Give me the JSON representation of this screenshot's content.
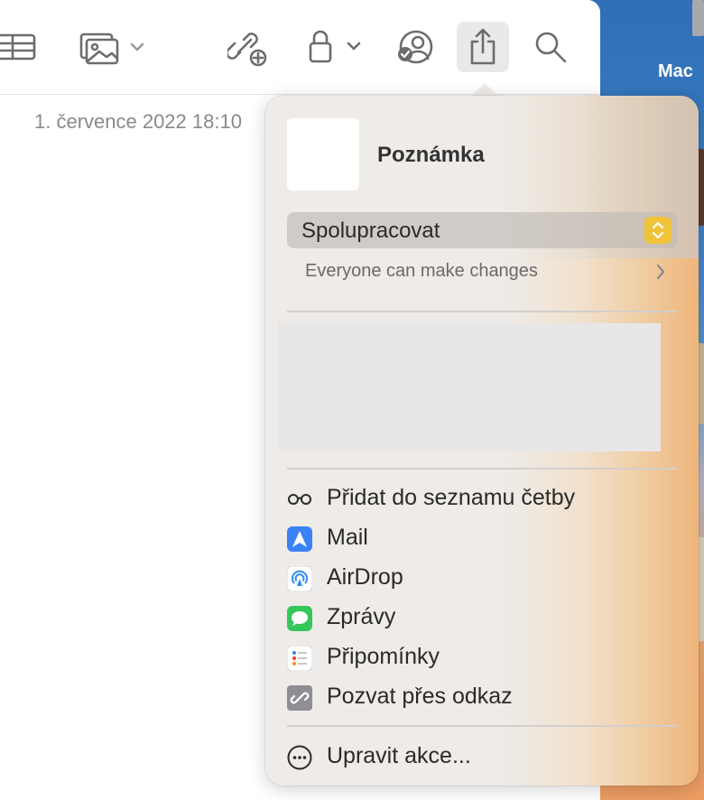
{
  "desktop": {
    "label": "Mac"
  },
  "toolbar": {
    "table_icon": "table-icon",
    "media_icon": "photo-icon",
    "collab_icon": "link-add-icon",
    "lock_icon": "lock-icon",
    "collab_status_icon": "person-check-icon",
    "share_icon": "share-icon",
    "search_icon": "search-icon"
  },
  "note": {
    "date": "1. července 2022 18:10"
  },
  "popover": {
    "title": "Poznámka",
    "mode_select": {
      "value": "Spolupracovat"
    },
    "permissions": "Everyone can make changes",
    "menu": [
      {
        "label": "Přidat do seznamu četby",
        "icon": "glasses-icon"
      },
      {
        "label": "Mail",
        "icon": "mail-icon",
        "color": "#3b82f6"
      },
      {
        "label": "AirDrop",
        "icon": "airdrop-icon",
        "color": "#2f8cf0"
      },
      {
        "label": "Zprávy",
        "icon": "messages-icon",
        "color": "#34c759"
      },
      {
        "label": "Připomínky",
        "icon": "reminders-icon"
      },
      {
        "label": "Pozvat přes odkaz",
        "icon": "link-icon",
        "color": "#8e8e93"
      }
    ],
    "edit_actions": {
      "label": "Upravit akce...",
      "icon": "more-icon"
    }
  },
  "colors": {
    "accent": "#f0c33a"
  }
}
